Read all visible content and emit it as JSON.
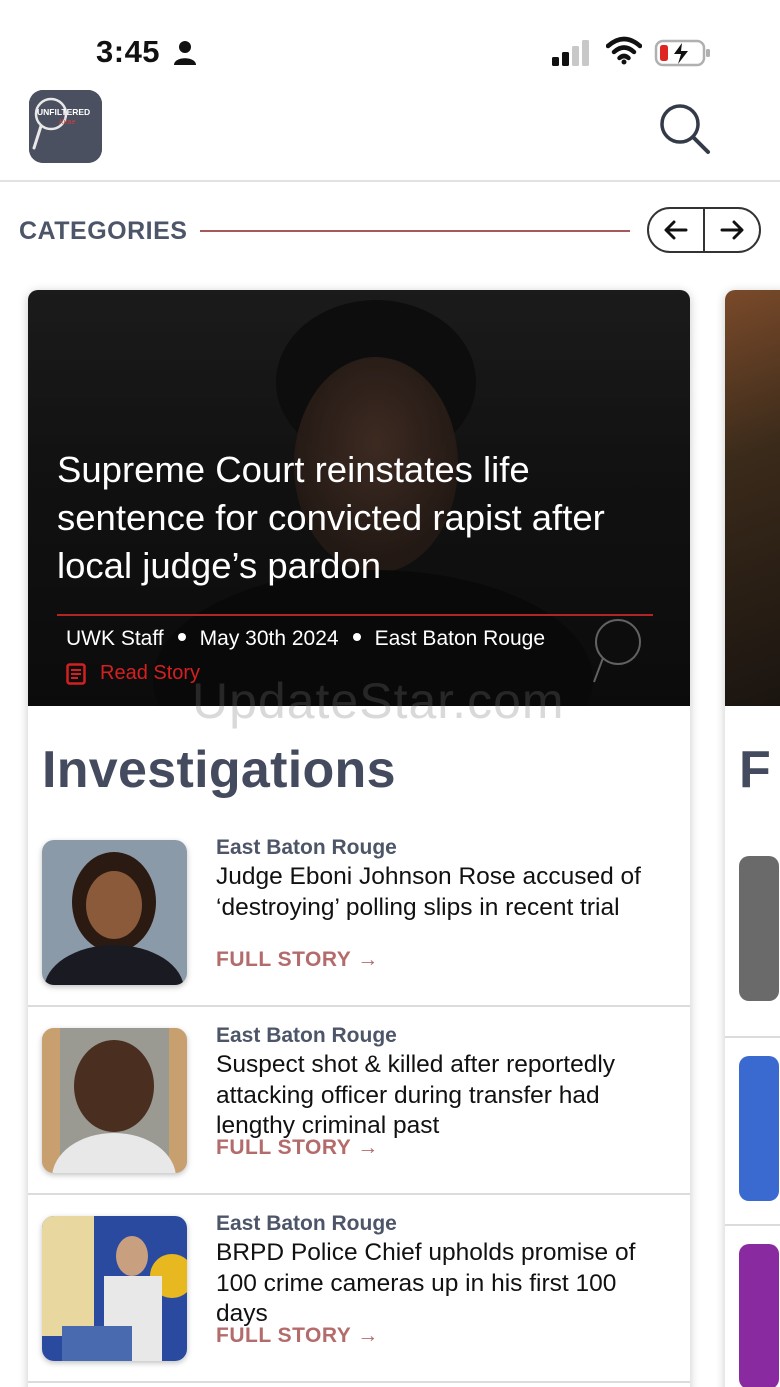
{
  "status_bar": {
    "time": "3:45"
  },
  "header": {
    "logo_text_top": "UNFILTERED",
    "logo_text_bottom": "with Kirae",
    "search_icon": "search-icon"
  },
  "categories": {
    "label": "CATEGORIES",
    "accent_color": "#a85858"
  },
  "featured": {
    "title": "Supreme Court reinstates life sentence for convicted rapist after local judge’s pardon",
    "author": "UWK Staff",
    "date": "May 30th 2024",
    "location": "East Baton Rouge",
    "read_label": "Read Story",
    "read_color": "#d42020"
  },
  "section": {
    "title": "Investigations",
    "stories": [
      {
        "location": "East Baton Rouge",
        "title": "Judge Eboni Johnson Rose accused of ‘destroying’ polling slips in recent trial",
        "link": "FULL STORY →"
      },
      {
        "location": "East Baton Rouge",
        "title": "Suspect shot & killed after reportedly attacking officer during transfer had lengthy criminal past",
        "link": "FULL STORY →"
      },
      {
        "location": "East Baton Rouge",
        "title": "BRPD Police Chief upholds promise of 100 crime cameras up in his first 100 days",
        "link": "FULL STORY →"
      }
    ]
  },
  "peek": {
    "section_letter": "F"
  },
  "watermark": "UpdateStar.com"
}
